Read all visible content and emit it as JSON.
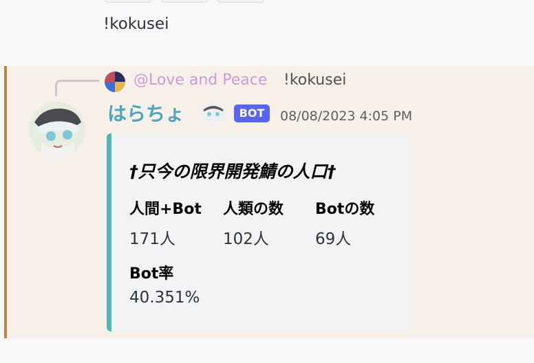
{
  "previous_message": {
    "text": "!kokusei"
  },
  "message": {
    "reply": {
      "mention": "@Love and Peace",
      "text": "!kokusei"
    },
    "author": {
      "name": "はらちょ",
      "tag": "BOT"
    },
    "timestamp": "08/08/2023 4:05 PM",
    "embed": {
      "title": "†只今の限界開発鯖の人口†",
      "accent_color": "#4bb7b9",
      "fields": [
        {
          "name": "人間+Bot",
          "value": "171人"
        },
        {
          "name": "人類の数",
          "value": "102人"
        },
        {
          "name": "Botの数",
          "value": "69人"
        },
        {
          "name": "Bot率",
          "value": "40.351%"
        }
      ]
    }
  },
  "colors": {
    "highlight_background": "#f7f0e9",
    "highlight_border": "#b98745",
    "username": "#4aa7bd",
    "mention": "#c99bd6",
    "bot_tag": "#5865f2"
  }
}
